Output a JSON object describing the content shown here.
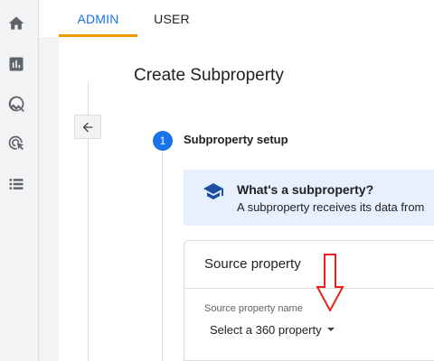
{
  "tabs": {
    "admin": "ADMIN",
    "user": "USER"
  },
  "page": {
    "title": "Create Subproperty"
  },
  "step": {
    "number": "1",
    "label": "Subproperty setup"
  },
  "info": {
    "title": "What's a subproperty?",
    "text": "A subproperty receives its data from"
  },
  "card": {
    "header": "Source property",
    "field_label": "Source property name",
    "select_value": "Select a 360 property"
  },
  "icons": {
    "nav": [
      "home-icon",
      "reports-icon",
      "explore-icon",
      "advertising-icon",
      "configure-icon"
    ],
    "back": "arrow-back-icon",
    "info": "school-icon",
    "annotation": "red-arrow-down"
  },
  "colors": {
    "accent": "#1a73e8",
    "tab_underline": "#f29900",
    "info_bg": "#e8f0fe",
    "annotation": "#e8221b"
  }
}
